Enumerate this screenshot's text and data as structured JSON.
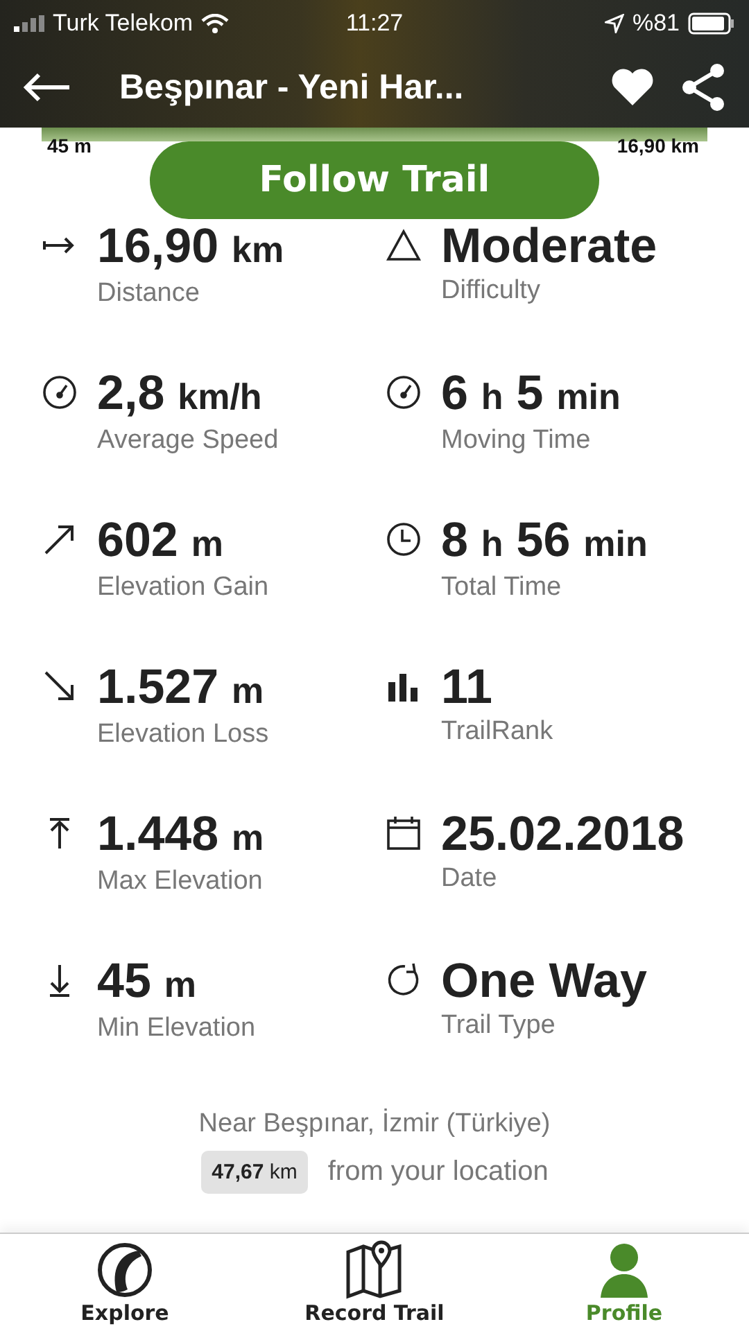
{
  "status_bar": {
    "carrier": "Turk Telekom",
    "time": "11:27",
    "battery": "%81"
  },
  "header": {
    "title": "Beşpınar - Yeni Har..."
  },
  "elevation_strip": {
    "start_label": "45 m",
    "end_label": "16,90 km"
  },
  "follow_button": {
    "label": "Follow Trail"
  },
  "stats": [
    {
      "parts": [
        {
          "text": "16,90",
          "kind": "number"
        },
        {
          "text": "km",
          "kind": "unit"
        }
      ],
      "label": "Distance"
    },
    {
      "parts": [
        {
          "text": "Moderate",
          "kind": "number"
        }
      ],
      "label": "Difficulty"
    },
    {
      "parts": [
        {
          "text": "2,8",
          "kind": "number"
        },
        {
          "text": "km/h",
          "kind": "unit"
        }
      ],
      "label": "Average Speed"
    },
    {
      "parts": [
        {
          "text": "6",
          "kind": "number"
        },
        {
          "text": "h",
          "kind": "unit"
        },
        {
          "text": "5",
          "kind": "number"
        },
        {
          "text": "min",
          "kind": "unit"
        }
      ],
      "label": "Moving Time"
    },
    {
      "parts": [
        {
          "text": "602",
          "kind": "number"
        },
        {
          "text": "m",
          "kind": "unit"
        }
      ],
      "label": "Elevation Gain"
    },
    {
      "parts": [
        {
          "text": "8",
          "kind": "number"
        },
        {
          "text": "h",
          "kind": "unit"
        },
        {
          "text": "56",
          "kind": "number"
        },
        {
          "text": "min",
          "kind": "unit"
        }
      ],
      "label": "Total Time"
    },
    {
      "parts": [
        {
          "text": "1.527",
          "kind": "number"
        },
        {
          "text": "m",
          "kind": "unit"
        }
      ],
      "label": "Elevation Loss"
    },
    {
      "parts": [
        {
          "text": "11",
          "kind": "number"
        }
      ],
      "label": "TrailRank"
    },
    {
      "parts": [
        {
          "text": "1.448",
          "kind": "number"
        },
        {
          "text": "m",
          "kind": "unit"
        }
      ],
      "label": "Max Elevation"
    },
    {
      "parts": [
        {
          "text": "25.02.2018",
          "kind": "number"
        }
      ],
      "label": "Date"
    },
    {
      "parts": [
        {
          "text": "45",
          "kind": "number"
        },
        {
          "text": "m",
          "kind": "unit"
        }
      ],
      "label": "Min Elevation"
    },
    {
      "parts": [
        {
          "text": "One Way",
          "kind": "number"
        }
      ],
      "label": "Trail Type"
    }
  ],
  "location": {
    "near": "Near Beşpınar, İzmir (Türkiye)",
    "distance_number": "47,67",
    "distance_unit": "km",
    "distance_suffix": "from your location"
  },
  "tabs": [
    {
      "label": "Explore",
      "selected": false
    },
    {
      "label": "Record Trail",
      "selected": false
    },
    {
      "label": "Profile",
      "selected": true
    }
  ]
}
